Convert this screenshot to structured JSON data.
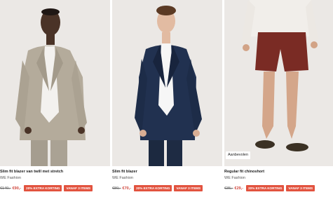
{
  "products": [
    {
      "title": "Slim fit blazer van twill met stretch",
      "brand": "WE Fashion",
      "price_old": "€140,-",
      "price_new": "€90,-",
      "badge_extra": "20% EXTRA KORTING",
      "badge_from": "VANAF 3 ITEMS",
      "recommended": ""
    },
    {
      "title": "Slim fit blazer",
      "brand": "WE Fashion",
      "price_old": "€80,-",
      "price_new": "€70,-",
      "badge_extra": "20% EXTRA KORTING",
      "badge_from": "VANAF 3 ITEMS",
      "recommended": ""
    },
    {
      "title": "Regular fit chinoshort",
      "brand": "WE Fashion",
      "price_old": "€35,-",
      "price_new": "€29,-",
      "badge_extra": "20% EXTRA KORTING",
      "badge_from": "VANAF 3 ITEMS",
      "recommended": "Aanbevolen"
    }
  ],
  "colors": {
    "photo_bg": "#ebe8e5",
    "sale_price": "#d0453b",
    "badge": "#e2533f"
  }
}
